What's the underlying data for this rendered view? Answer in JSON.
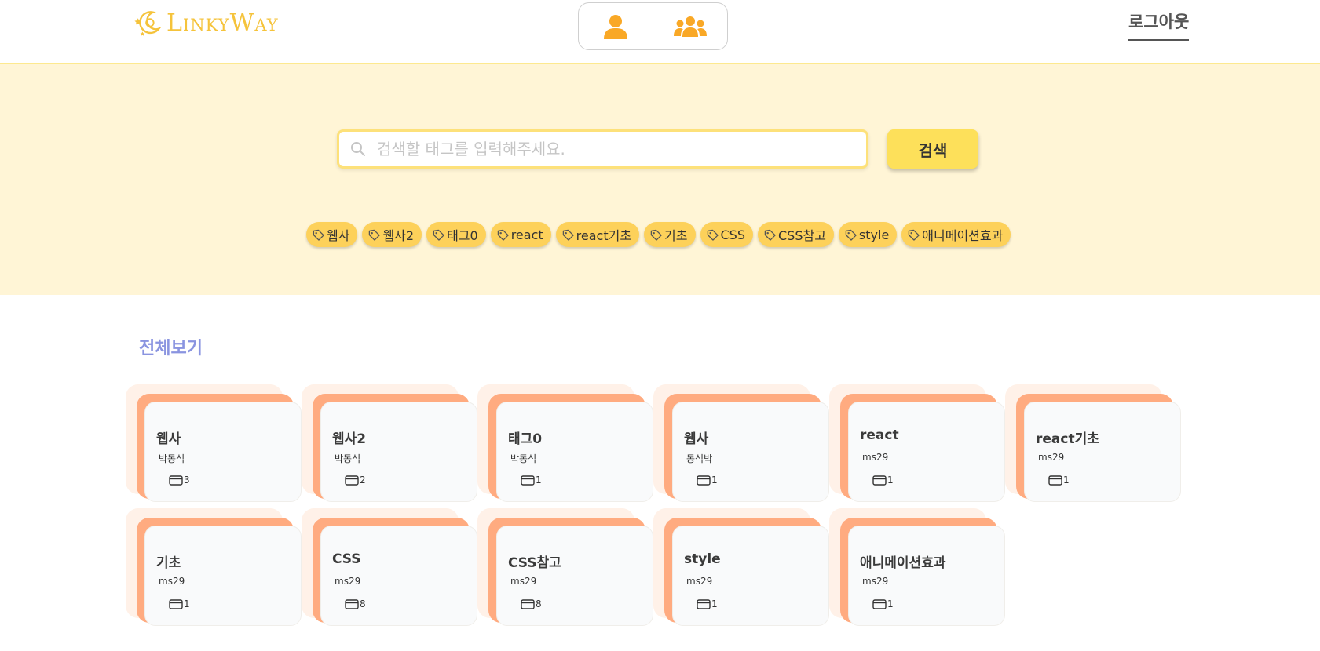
{
  "header": {
    "logo_text": "LinkyWay",
    "logout_label": "로그아웃",
    "toggle": [
      {
        "icon": "user-icon"
      },
      {
        "icon": "users-icon"
      }
    ]
  },
  "search": {
    "placeholder": "검색할 태그를 입력해주세요.",
    "button_label": "검색"
  },
  "tags": [
    "웹사",
    "웹사2",
    "태그0",
    "react",
    "react기초",
    "기초",
    "CSS",
    "CSS참고",
    "style",
    "애니메이션효과"
  ],
  "section_title": "전체보기",
  "cards": [
    {
      "title": "웹사",
      "author": "박동석",
      "count": "3"
    },
    {
      "title": "웹사2",
      "author": "박동석",
      "count": "2"
    },
    {
      "title": "태그0",
      "author": "박동석",
      "count": "1"
    },
    {
      "title": "웹사",
      "author": "동석박",
      "count": "1"
    },
    {
      "title": "react",
      "author": "ms29",
      "count": "1"
    },
    {
      "title": "react기초",
      "author": "ms29",
      "count": "1"
    },
    {
      "title": "기초",
      "author": "ms29",
      "count": "1"
    },
    {
      "title": "CSS",
      "author": "ms29",
      "count": "8"
    },
    {
      "title": "CSS참고",
      "author": "ms29",
      "count": "8"
    },
    {
      "title": "style",
      "author": "ms29",
      "count": "1"
    },
    {
      "title": "애니메이션효과",
      "author": "ms29",
      "count": "1"
    }
  ],
  "colors": {
    "accent_yellow": "#fde05a",
    "hero_bg": "#fff5d6",
    "card_accent": "#ffab80",
    "toggle_icon": "#f9a826",
    "section_title": "#8a94e0"
  }
}
